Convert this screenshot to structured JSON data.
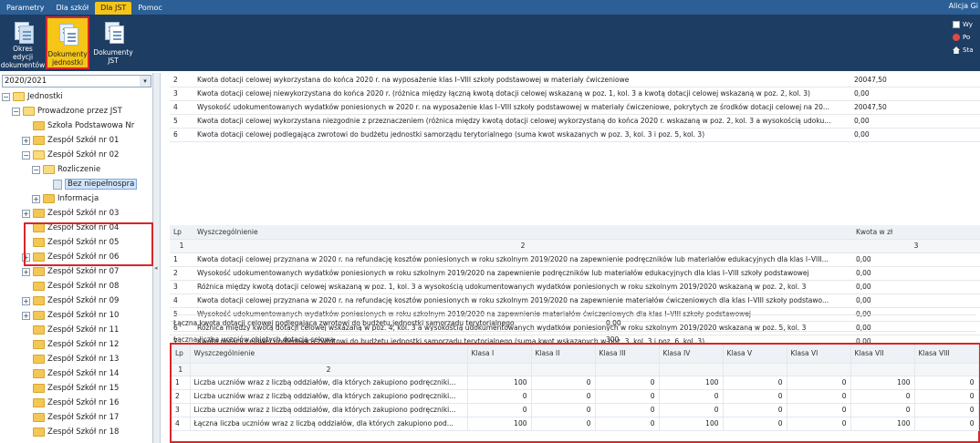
{
  "menu": {
    "tabs": [
      "Parametry",
      "Dla szkół",
      "Dla JST",
      "Pomoc"
    ],
    "active_tab": "Dla JST",
    "user": "Alicja Gi"
  },
  "ribbon": {
    "buttons": [
      {
        "label_line1": "Okres edycji",
        "label_line2": "dokumentów",
        "icon": "documents-period-icon"
      },
      {
        "label_line1": "Dokumenty",
        "label_line2": "jednostki",
        "icon": "unit-documents-icon"
      },
      {
        "label_line1": "Dokumenty",
        "label_line2": "JST",
        "icon": "jst-documents-icon"
      }
    ],
    "right_items": [
      "Wy",
      "Po",
      "Sta"
    ]
  },
  "sidebar": {
    "year": "2020/2021",
    "tree": [
      {
        "label": "Jednostki",
        "level": 0,
        "expanded": true
      },
      {
        "label": "Prowadzone przez JST",
        "level": 1,
        "expanded": true
      },
      {
        "label": "Szkoła Podstawowa Nr",
        "level": 2,
        "expanded": null
      },
      {
        "label": "Zespół Szkół nr 01",
        "level": 2,
        "expanded": false
      },
      {
        "label": "Zespół Szkół nr 02",
        "level": 2,
        "expanded": true
      },
      {
        "label": "Rozliczenie",
        "level": 3,
        "expanded": true
      },
      {
        "label": "Bez niepełnospra",
        "level": 4,
        "expanded": null,
        "selected": true
      },
      {
        "label": "Informacja",
        "level": 3,
        "expanded": false
      },
      {
        "label": "Zespół Szkół nr 03",
        "level": 2,
        "expanded": false
      },
      {
        "label": "Zespół Szkół nr 04",
        "level": 2,
        "expanded": null
      },
      {
        "label": "Zespół Szkół nr 05",
        "level": 2,
        "expanded": null
      },
      {
        "label": "Zespół Szkół nr 06",
        "level": 2,
        "expanded": false
      },
      {
        "label": "Zespół Szkół nr 07",
        "level": 2,
        "expanded": false
      },
      {
        "label": "Zespół Szkół nr 08",
        "level": 2,
        "expanded": null
      },
      {
        "label": "Zespół Szkół nr 09",
        "level": 2,
        "expanded": false
      },
      {
        "label": "Zespół Szkół nr 10",
        "level": 2,
        "expanded": false
      },
      {
        "label": "Zespół Szkół nr 11",
        "level": 2,
        "expanded": null
      },
      {
        "label": "Zespół Szkół nr 12",
        "level": 2,
        "expanded": null
      },
      {
        "label": "Zespół Szkół nr 13",
        "level": 2,
        "expanded": null
      },
      {
        "label": "Zespół Szkół nr 14",
        "level": 2,
        "expanded": null
      },
      {
        "label": "Zespół Szkół nr 15",
        "level": 2,
        "expanded": null
      },
      {
        "label": "Zespół Szkół nr 16",
        "level": 2,
        "expanded": null
      },
      {
        "label": "Zespół Szkół nr 17",
        "level": 2,
        "expanded": null
      },
      {
        "label": "Zespół Szkół nr 18",
        "level": 2,
        "expanded": null
      }
    ]
  },
  "table1": {
    "rows": [
      {
        "lp": "2",
        "desc": "Kwota dotacji celowej wykorzystana do końca 2020 r. na wyposażenie klas I–VIII szkoły podstawowej w materiały ćwiczeniowe",
        "value": "20047,50"
      },
      {
        "lp": "3",
        "desc": "Kwota dotacji celowej niewykorzystana do końca 2020 r. (różnica między łączną kwotą dotacji celowej wskazaną w poz. 1, kol. 3 a kwotą dotacji celowej wskazaną w poz. 2, kol. 3)",
        "value": "0,00"
      },
      {
        "lp": "4",
        "desc": "Wysokość udokumentowanych wydatków poniesionych w 2020 r. na wyposażenie klas I–VIII szkoły podstawowej w materiały ćwiczeniowe, pokrytych ze środków dotacji celowej na 20...",
        "value": "20047,50"
      },
      {
        "lp": "5",
        "desc": "Kwota dotacji celowej wykorzystana niezgodnie z przeznaczeniem (różnica między kwotą dotacji celowej wykorzystaną do końca 2020 r. wskazaną w poz. 2, kol. 3 a wysokością udoku...",
        "value": "0,00"
      },
      {
        "lp": "6",
        "desc": "Kwota dotacji celowej podlegająca zwrotowi do budżetu jednostki samorządu terytorialnego (suma kwot wskazanych w poz. 3, kol. 3 i poz. 5, kol. 3)",
        "value": "0,00"
      }
    ]
  },
  "table2": {
    "header": {
      "lp": "Lp",
      "desc": "Wyszczególnienie",
      "value": "Kwota w zł"
    },
    "numbers": {
      "lp": "1",
      "desc": "2",
      "value": "3"
    },
    "rows": [
      {
        "lp": "1",
        "desc": "Kwota dotacji celowej przyznana w 2020 r. na refundację kosztów poniesionych w roku szkolnym 2019/2020 na zapewnienie podręczników lub materiałów edukacyjnych dla klas I–VIII...",
        "value": "0,00"
      },
      {
        "lp": "2",
        "desc": "Wysokość udokumentowanych wydatków poniesionych w roku szkolnym 2019/2020 na zapewnienie podręczników lub materiałów edukacyjnych dla klas I–VIII szkoły podstawowej",
        "value": "0,00"
      },
      {
        "lp": "3",
        "desc": "Różnica między kwotą dotacji celowej wskazaną w poz. 1, kol. 3 a wysokością udokumentowanych wydatków poniesionych w roku szkolnym 2019/2020 wskazaną w poz. 2, kol. 3",
        "value": "0,00"
      },
      {
        "lp": "4",
        "desc": "Kwota dotacji celowej przyznana w 2020 r. na refundację kosztów poniesionych w roku szkolnym 2019/2020 na zapewnienie materiałów ćwiczeniowych dla klas I–VIII szkoły podstawo...",
        "value": "0,00"
      },
      {
        "lp": "5",
        "desc": "Wysokość udokumentowanych wydatków poniesionych w roku szkolnym 2019/2020 na zapewnienie materiałów ćwiczeniowych dla klas I–VIII szkoły podstawowej",
        "value": "0,00"
      },
      {
        "lp": "6",
        "desc": "Różnica między kwotą dotacji celowej wskazaną w poz. 4, kol. 3 a wysokością udokumentowanych wydatków poniesionych w roku szkolnym 2019/2020 wskazaną w poz. 5, kol. 3",
        "value": "0,00"
      },
      {
        "lp": "7",
        "desc": "Kwota dotacji celowej podlegająca zwrotowi do budżetu jednostki samorządu terytorialnego (suma kwot wskazanych w poz. 3, kol. 3 i poz. 6, kol. 3)",
        "value": "0,00"
      }
    ]
  },
  "summary": {
    "return_label": "Łączna kwota dotacji celowej podlegająca zwrotowi do budżetu jednostki samorządu terytorialnego",
    "return_value": "0,00",
    "students_label": "Łączna liczba uczniów objętych dotacją celową",
    "students_value": "300"
  },
  "table3": {
    "header": [
      "Lp",
      "Wyszczególnienie",
      "Klasa I",
      "Klasa II",
      "Klasa III",
      "Klasa IV",
      "Klasa V",
      "Klasa VI",
      "Klasa VII",
      "Klasa VIII"
    ],
    "numbers": [
      "1",
      "2"
    ],
    "rows": [
      {
        "lp": "1",
        "desc": "Liczba uczniów wraz z liczbą oddziałów, dla których zakupiono podręczniki...",
        "values": [
          "100",
          "0",
          "0",
          "100",
          "0",
          "0",
          "100",
          "0"
        ]
      },
      {
        "lp": "2",
        "desc": "Liczba uczniów wraz z liczbą oddziałów, dla których zakupiono podręczniki...",
        "values": [
          "0",
          "0",
          "0",
          "0",
          "0",
          "0",
          "0",
          "0"
        ]
      },
      {
        "lp": "3",
        "desc": "Liczba uczniów wraz z liczbą oddziałów, dla których zakupiono podręczniki...",
        "values": [
          "0",
          "0",
          "0",
          "0",
          "0",
          "0",
          "0",
          "0"
        ]
      },
      {
        "lp": "4",
        "desc": "Łączna liczba uczniów wraz z liczbą oddziałów, dla których zakupiono pod...",
        "values": [
          "100",
          "0",
          "0",
          "100",
          "0",
          "0",
          "100",
          "0"
        ]
      }
    ]
  }
}
